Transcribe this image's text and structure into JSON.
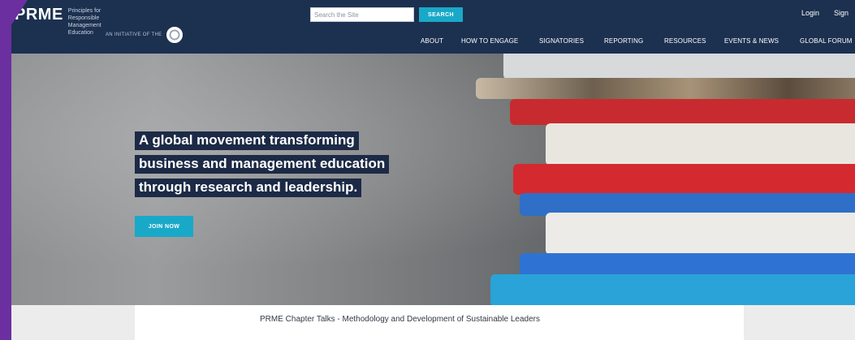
{
  "header": {
    "logo": "PRME",
    "logo_subtitle": "Principles for Responsible Management Education",
    "initiative_text": "AN INITIATIVE OF THE",
    "initiative_icon": "un-emblem-icon",
    "search": {
      "placeholder": "Search the Site",
      "button_label": "SEARCH"
    },
    "login_label": "Login",
    "signup_label": "Sign"
  },
  "nav": {
    "items": [
      {
        "label": "ABOUT"
      },
      {
        "label": "HOW TO ENGAGE"
      },
      {
        "label": "SIGNATORIES"
      },
      {
        "label": "REPORTING"
      },
      {
        "label": "RESOURCES"
      },
      {
        "label": "EVENTS & NEWS"
      },
      {
        "label": "GLOBAL FORUM"
      }
    ]
  },
  "hero": {
    "headline_lines": [
      "A global movement transforming",
      "business and management education",
      "through research and leadership."
    ],
    "cta_label": "JOIN NOW"
  },
  "featured": {
    "title": "PRME Chapter Talks - Methodology and Development of Sustainable Leaders"
  },
  "colors": {
    "header_bg": "#1c3050",
    "accent": "#19a9c8",
    "headline_bg": "#1c2a46",
    "purple_edge": "#6b2fa0"
  }
}
